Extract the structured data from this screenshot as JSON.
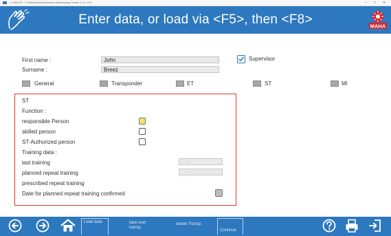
{
  "window": {
    "title": "1.9.85.312 · © MAHA Maschinenbau Haldenwang GmbH & Co. KG",
    "controls": [
      "–",
      "□",
      "✕"
    ]
  },
  "header": {
    "title": "Enter data, or load via <F5>, then <F8>",
    "logo_text": "MAHA",
    "colors": {
      "bar": "#2d78bf",
      "logo_red": "#d9232d"
    }
  },
  "form": {
    "first_name_label": "First name :",
    "first_name_value": "John",
    "surname_label": "Surname :",
    "surname_value": "Breez",
    "supervisor_label": "Supervisor",
    "supervisor_checked": true
  },
  "tabs": [
    {
      "label": "General"
    },
    {
      "label": "Transponder"
    },
    {
      "label": "ET"
    },
    {
      "label": "ST"
    },
    {
      "label": "MI"
    }
  ],
  "st_section": {
    "heading": "ST",
    "function_label": "Function :",
    "functions": [
      {
        "label": "responsible Person",
        "state": "highlighted"
      },
      {
        "label": "skilled person",
        "state": "unchecked"
      },
      {
        "label": "ST-Authorized person",
        "state": "unchecked"
      }
    ],
    "training_label": "Training data :",
    "last_training_label": "last training",
    "last_training_value": ". .",
    "planned_repeat_label": "planned repeat training",
    "planned_repeat_value": ". .",
    "prescribed_repeat_label": "prescribed repeat training",
    "prescribed_repeat_value": ". .",
    "date_confirmed_label": "Date for planned repeat training confirmed"
  },
  "bottom": {
    "commands": [
      {
        "label": "Load data"
      },
      {
        "label": "take over transp."
      },
      {
        "label": "delete Transp."
      },
      {
        "label": "Continue"
      }
    ]
  }
}
